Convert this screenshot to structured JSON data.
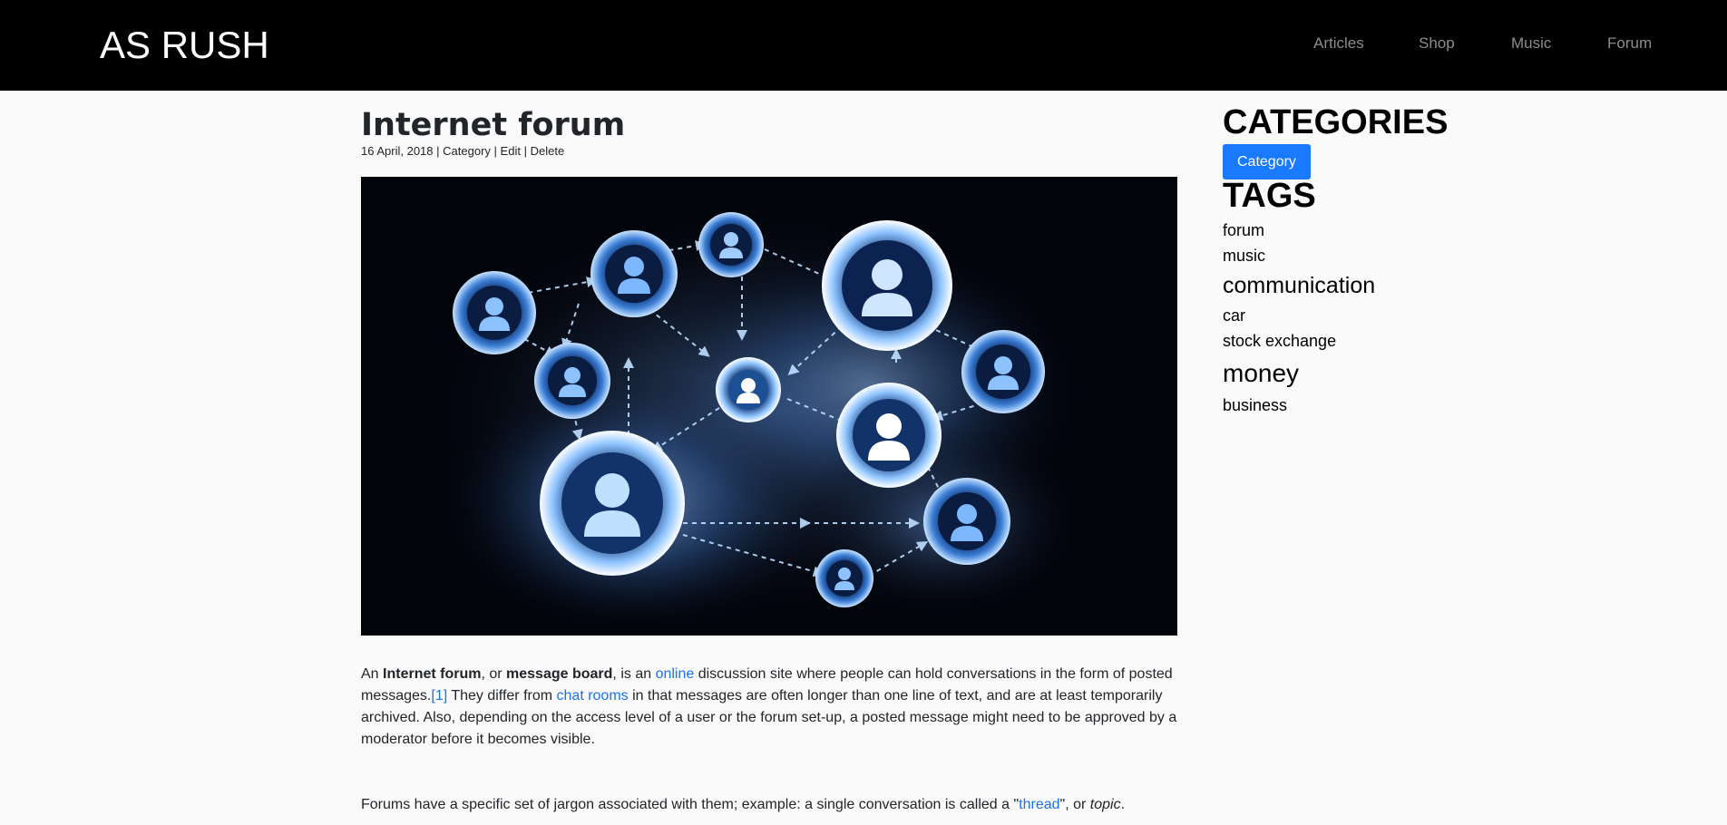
{
  "navbar": {
    "brand": "AS RUSH",
    "links": [
      "Articles",
      "Shop",
      "Music",
      "Forum"
    ]
  },
  "post": {
    "title": "Internet forum",
    "date": "16 April, 2018",
    "separator": "|",
    "meta_links": [
      "Category",
      "Edit",
      "Delete"
    ],
    "image_alt": "network of connected user icons",
    "paragraph1": {
      "t1": "An ",
      "b1": "Internet forum",
      "t2": ", or ",
      "b2": "message board",
      "t3": ", is an ",
      "link_online": "online",
      "t4": " discussion site where people can hold conversations in the form of posted messages.",
      "link_ref": "[1]",
      "t5": " They differ from ",
      "link_chat": "chat rooms",
      "t6": " in that messages are often longer than one line of text, and are at least temporarily archived. Also, depending on the access level of a user or the forum set-up, a posted message might need to be approved by a moderator before it becomes visible."
    },
    "paragraph2": {
      "t1": "Forums have a specific set of jargon associated with them; example: a single conversation is called a \"",
      "link_thread": "thread",
      "t2": "\", or ",
      "i1": "topic",
      "t3": "."
    }
  },
  "sidebar": {
    "categories_heading": "CATEGORIES",
    "category_button": "Category",
    "tags_heading": "TAGS",
    "tags": [
      "forum",
      "music",
      "communication",
      "car",
      "stock exchange",
      "money",
      "business"
    ]
  }
}
